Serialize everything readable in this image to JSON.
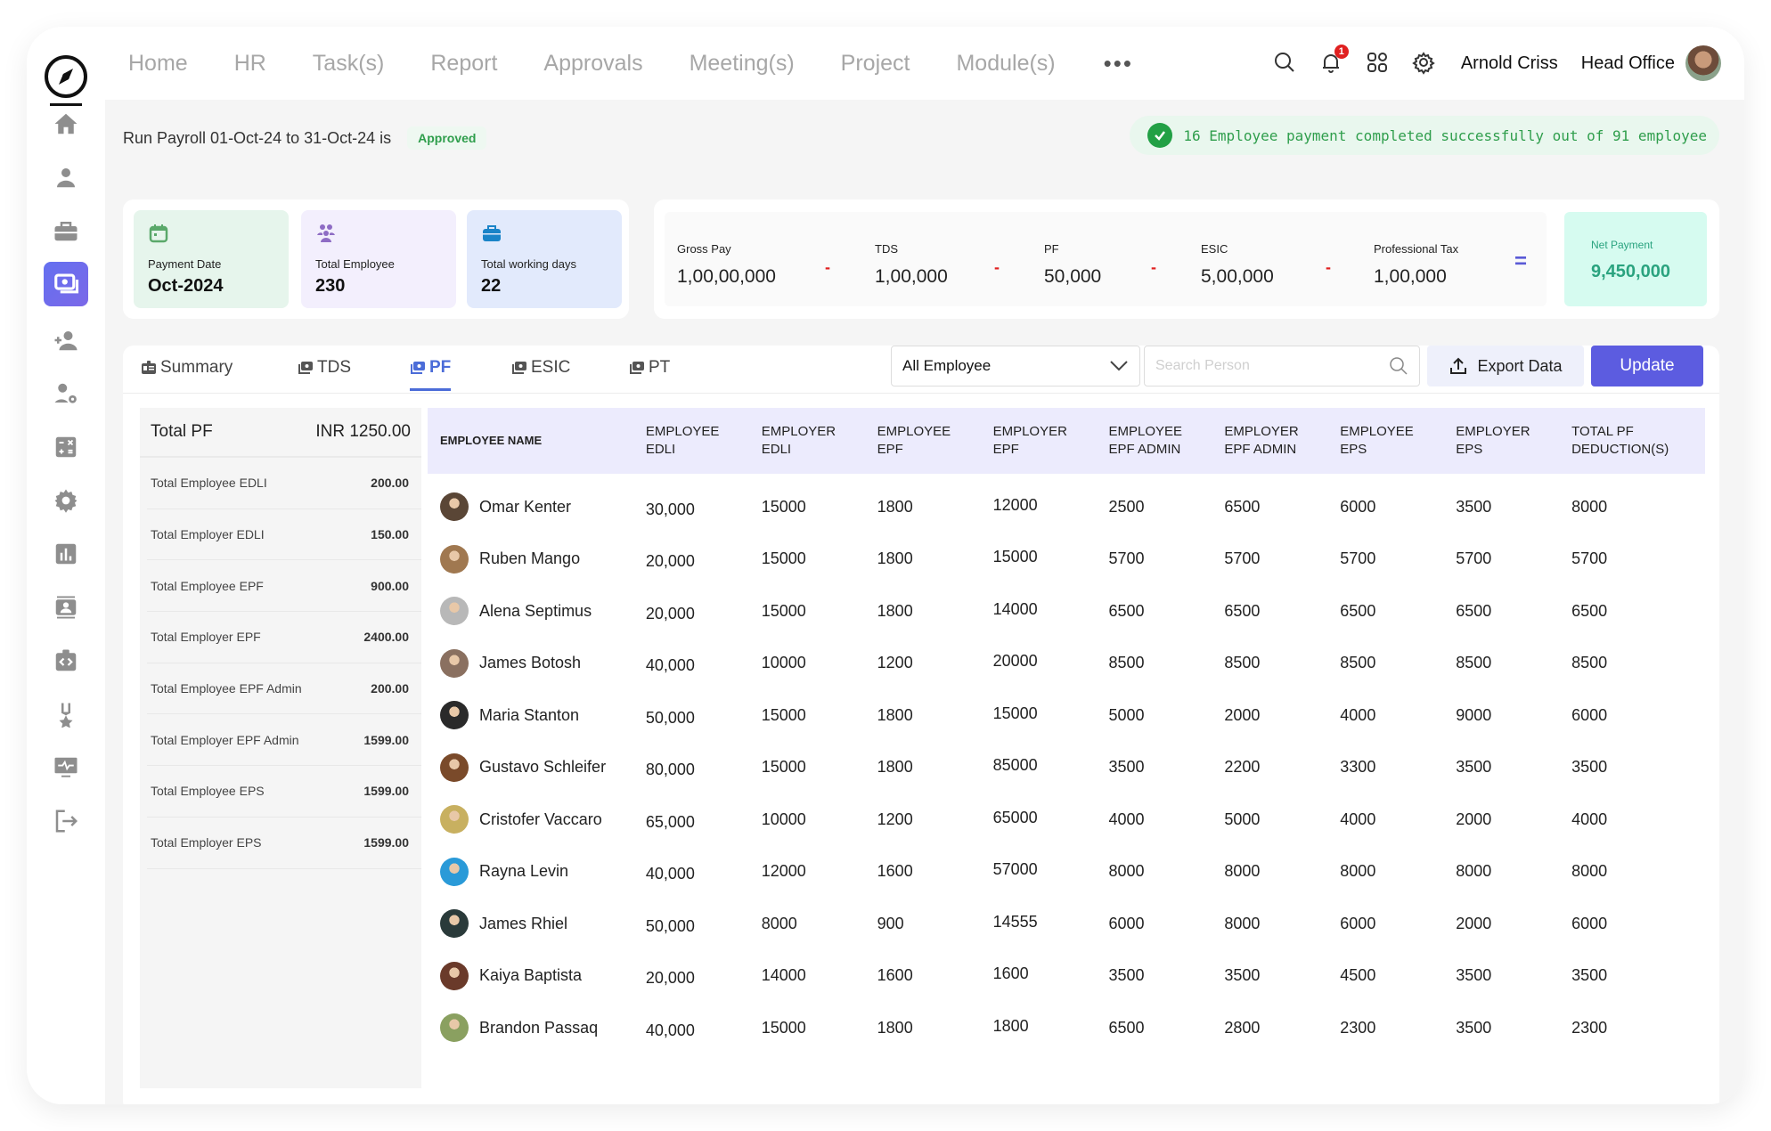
{
  "nav": {
    "items": [
      "Home",
      "HR",
      "Task(s)",
      "Report",
      "Approvals",
      "Meeting(s)",
      "Project",
      "Module(s)"
    ],
    "more": "•••",
    "notification_count": "1",
    "user_name": "Arnold Criss",
    "office": "Head Office"
  },
  "sidebar": {
    "items": [
      {
        "name": "home",
        "icon": "home-icon"
      },
      {
        "name": "profile",
        "icon": "user-icon"
      },
      {
        "name": "jobs",
        "icon": "briefcase-icon"
      },
      {
        "name": "payroll",
        "icon": "money-icon",
        "active": true
      },
      {
        "name": "add-user",
        "icon": "add-user-icon"
      },
      {
        "name": "user-settings",
        "icon": "user-gear-icon"
      },
      {
        "name": "calculator",
        "icon": "calculator-icon"
      },
      {
        "name": "settings",
        "icon": "gear-icon"
      },
      {
        "name": "reports",
        "icon": "bar-chart-icon"
      },
      {
        "name": "contacts",
        "icon": "contact-card-icon"
      },
      {
        "name": "developer",
        "icon": "code-clipboard-icon"
      },
      {
        "name": "awards",
        "icon": "medal-icon"
      },
      {
        "name": "monitor",
        "icon": "monitor-pulse-icon"
      },
      {
        "name": "logout",
        "icon": "logout-icon"
      }
    ]
  },
  "status": {
    "text": "Run Payroll 01-Oct-24 to 31-Oct-24 is",
    "badge": "Approved",
    "success_message": "16 Employee payment completed successfully out of 91 employee"
  },
  "stats": [
    {
      "label": "Payment Date",
      "value": "Oct-2024",
      "color": "#5aa86a",
      "bg": "#e6f5ec"
    },
    {
      "label": "Total Employee",
      "value": "230",
      "color": "#8e6cc4",
      "bg": "#f3effd"
    },
    {
      "label": "Total working days",
      "value": "22",
      "color": "#1a84c8",
      "bg": "#e2eafc"
    }
  ],
  "calc": {
    "items": [
      {
        "label": "Gross Pay",
        "value": "1,00,00,000"
      },
      {
        "label": "TDS",
        "value": "1,00,000"
      },
      {
        "label": "PF",
        "value": "50,000"
      },
      {
        "label": "ESIC",
        "value": "5,00,000"
      },
      {
        "label": "Professional Tax",
        "value": "1,00,000"
      }
    ],
    "minus": "-",
    "equals": "=",
    "net_label": "Net Payment",
    "net_value": "9,450,000"
  },
  "tabs": [
    {
      "label": "Summary"
    },
    {
      "label": "TDS"
    },
    {
      "label": "PF",
      "active": true
    },
    {
      "label": "ESIC"
    },
    {
      "label": "PT"
    }
  ],
  "filters": {
    "employee_select": "All Employee",
    "search_placeholder": "Search Person",
    "export_label": "Export Data",
    "update_label": "Update"
  },
  "summary": {
    "title": "Total PF",
    "total": "INR 1250.00",
    "rows": [
      {
        "label": "Total Employee EDLI",
        "value": "200.00"
      },
      {
        "label": "Total Employer EDLI",
        "value": "150.00"
      },
      {
        "label": "Total Employee EPF",
        "value": "900.00"
      },
      {
        "label": "Total Employer EPF",
        "value": "2400.00"
      },
      {
        "label": "Total Employee EPF Admin",
        "value": "200.00"
      },
      {
        "label": "Total Employer EPF Admin",
        "value": "1599.00"
      },
      {
        "label": "Total Employee EPS",
        "value": "1599.00"
      },
      {
        "label": "Total Employer EPS",
        "value": "1599.00"
      }
    ]
  },
  "table": {
    "headers": [
      [
        "Employee Name"
      ],
      [
        "Employee",
        "EDLI"
      ],
      [
        "Employer",
        "EDLI"
      ],
      [
        "Employee",
        "EPF"
      ],
      [
        "Employer",
        "EPF"
      ],
      [
        "Employee",
        "EPF Admin"
      ],
      [
        "Employer",
        "EPF Admin"
      ],
      [
        "Employee",
        "EPS"
      ],
      [
        "Employer",
        "EPS"
      ],
      [
        "Total PF",
        "Deduction(s)"
      ]
    ],
    "rows": [
      {
        "name": "Omar Kenter",
        "avatar": "#5a4636",
        "values": [
          "30,000",
          "15000",
          "1800",
          "12000",
          "2500",
          "6500",
          "6000",
          "3500",
          "8000"
        ]
      },
      {
        "name": "Ruben Mango",
        "avatar": "#a07850",
        "values": [
          "20,000",
          "15000",
          "1800",
          "15000",
          "5700",
          "5700",
          "5700",
          "5700",
          "5700"
        ]
      },
      {
        "name": "Alena Septimus",
        "avatar": "#b8b8b8",
        "values": [
          "20,000",
          "15000",
          "1800",
          "14000",
          "6500",
          "6500",
          "6500",
          "6500",
          "6500"
        ]
      },
      {
        "name": "James Botosh",
        "avatar": "#8a7060",
        "values": [
          "40,000",
          "10000",
          "1200",
          "20000",
          "8500",
          "8500",
          "8500",
          "8500",
          "8500"
        ]
      },
      {
        "name": "Maria Stanton",
        "avatar": "#2a2a2a",
        "values": [
          "50,000",
          "15000",
          "1800",
          "15000",
          "5000",
          "2000",
          "4000",
          "9000",
          "6000"
        ]
      },
      {
        "name": "Gustavo Schleifer",
        "avatar": "#7a4a2a",
        "values": [
          "80,000",
          "15000",
          "1800",
          "85000",
          "3500",
          "2200",
          "3300",
          "3500",
          "3500"
        ]
      },
      {
        "name": "Cristofer Vaccaro",
        "avatar": "#c8b060",
        "values": [
          "65,000",
          "10000",
          "1200",
          "65000",
          "4000",
          "5000",
          "4000",
          "2000",
          "4000"
        ]
      },
      {
        "name": "Rayna Levin",
        "avatar": "#2a9ad8",
        "values": [
          "40,000",
          "12000",
          "1600",
          "57000",
          "8000",
          "8000",
          "8000",
          "8000",
          "8000"
        ]
      },
      {
        "name": "James Rhiel",
        "avatar": "#2a3a3a",
        "values": [
          "50,000",
          "8000",
          "900",
          "14555",
          "6000",
          "8000",
          "6000",
          "2000",
          "6000"
        ]
      },
      {
        "name": "Kaiya Baptista",
        "avatar": "#6a3a2a",
        "values": [
          "20,000",
          "14000",
          "1600",
          "1600",
          "3500",
          "3500",
          "4500",
          "3500",
          "3500"
        ]
      },
      {
        "name": "Brandon Passaq",
        "avatar": "#8aa060",
        "values": [
          "40,000",
          "15000",
          "1800",
          "1800",
          "6500",
          "2800",
          "2300",
          "3500",
          "2300"
        ]
      }
    ]
  }
}
